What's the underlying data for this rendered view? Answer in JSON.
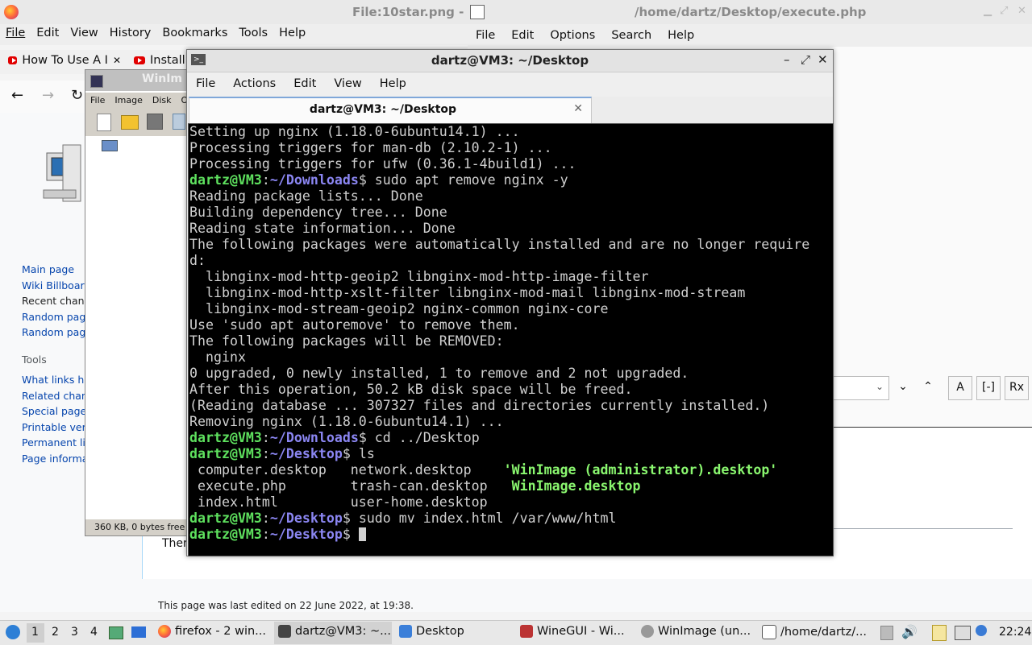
{
  "firefox": {
    "title": "File:10star.png -",
    "menu": [
      "File",
      "Edit",
      "View",
      "History",
      "Bookmarks",
      "Tools",
      "Help"
    ],
    "tabs": [
      "How To Use A I",
      "Installi"
    ],
    "wiki": {
      "nav_links": [
        "Main page",
        "Wiki Billboar",
        "Recent chan",
        "Random pag",
        "Random pag"
      ],
      "tools_heading": "Tools",
      "tool_links": [
        "What links he",
        "Related chan",
        "Special page",
        "Printable ver",
        "Permanent li",
        "Page informa"
      ],
      "body_fragment": "Ther",
      "footer": "This page was last edited on 22 June 2022, at 19:38."
    }
  },
  "editor": {
    "title": "/home/dartz/Desktop/execute.php",
    "menu": [
      "File",
      "Edit",
      "Options",
      "Search",
      "Help"
    ]
  },
  "winimage": {
    "title": "WinIm",
    "menu": [
      "File",
      "Image",
      "Disk",
      "Op"
    ],
    "status": "360 KB, 0 bytes free"
  },
  "terminal": {
    "title": "dartz@VM3: ~/Desktop",
    "menu": [
      "File",
      "Actions",
      "Edit",
      "View",
      "Help"
    ],
    "tab_title": "dartz@VM3: ~/Desktop",
    "lines": [
      [
        {
          "t": "Setting up nginx (1.18.0-6ubuntu14.1) ...",
          "c": ""
        }
      ],
      [
        {
          "t": "Processing triggers for man-db (2.10.2-1) ...",
          "c": ""
        }
      ],
      [
        {
          "t": "Processing triggers for ufw (0.36.1-4build1) ...",
          "c": ""
        }
      ],
      [
        {
          "t": "dartz@VM3",
          "c": "pg"
        },
        {
          "t": ":",
          "c": ""
        },
        {
          "t": "~/Downloads",
          "c": "pp"
        },
        {
          "t": "$ sudo apt remove nginx -y",
          "c": ""
        }
      ],
      [
        {
          "t": "Reading package lists... Done",
          "c": ""
        }
      ],
      [
        {
          "t": "Building dependency tree... Done",
          "c": ""
        }
      ],
      [
        {
          "t": "Reading state information... Done",
          "c": ""
        }
      ],
      [
        {
          "t": "The following packages were automatically installed and are no longer require",
          "c": ""
        }
      ],
      [
        {
          "t": "d:",
          "c": ""
        }
      ],
      [
        {
          "t": "  libnginx-mod-http-geoip2 libnginx-mod-http-image-filter",
          "c": ""
        }
      ],
      [
        {
          "t": "  libnginx-mod-http-xslt-filter libnginx-mod-mail libnginx-mod-stream",
          "c": ""
        }
      ],
      [
        {
          "t": "  libnginx-mod-stream-geoip2 nginx-common nginx-core",
          "c": ""
        }
      ],
      [
        {
          "t": "Use 'sudo apt autoremove' to remove them.",
          "c": ""
        }
      ],
      [
        {
          "t": "The following packages will be REMOVED:",
          "c": ""
        }
      ],
      [
        {
          "t": "  nginx",
          "c": ""
        }
      ],
      [
        {
          "t": "0 upgraded, 0 newly installed, 1 to remove and 2 not upgraded.",
          "c": ""
        }
      ],
      [
        {
          "t": "After this operation, 50.2 kB disk space will be freed.",
          "c": ""
        }
      ],
      [
        {
          "t": "(Reading database ... 307327 files and directories currently installed.)",
          "c": ""
        }
      ],
      [
        {
          "t": "Removing nginx (1.18.0-6ubuntu14.1) ...",
          "c": ""
        }
      ],
      [
        {
          "t": "dartz@VM3",
          "c": "pg"
        },
        {
          "t": ":",
          "c": ""
        },
        {
          "t": "~/Downloads",
          "c": "pp"
        },
        {
          "t": "$ cd ../Desktop",
          "c": ""
        }
      ],
      [
        {
          "t": "dartz@VM3",
          "c": "pg"
        },
        {
          "t": ":",
          "c": ""
        },
        {
          "t": "~/Desktop",
          "c": "pp"
        },
        {
          "t": "$ ls",
          "c": ""
        }
      ],
      [
        {
          "t": " computer.desktop   network.desktop    ",
          "c": ""
        },
        {
          "t": "'WinImage (administrator).desktop'",
          "c": "ex"
        }
      ],
      [
        {
          "t": " execute.php        trash-can.desktop   ",
          "c": ""
        },
        {
          "t": "WinImage.desktop",
          "c": "ex"
        }
      ],
      [
        {
          "t": " index.html         user-home.desktop",
          "c": ""
        }
      ],
      [
        {
          "t": "dartz@VM3",
          "c": "pg"
        },
        {
          "t": ":",
          "c": ""
        },
        {
          "t": "~/Desktop",
          "c": "pp"
        },
        {
          "t": "$ sudo mv index.html /var/www/html",
          "c": ""
        }
      ],
      [
        {
          "t": "dartz@VM3",
          "c": "pg"
        },
        {
          "t": ":",
          "c": ""
        },
        {
          "t": "~/Desktop",
          "c": "pp"
        },
        {
          "t": "$ ",
          "c": ""
        },
        {
          "t": "",
          "c": "cursor"
        }
      ]
    ]
  },
  "taskbar": {
    "workspaces": [
      "1",
      "2",
      "3",
      "4"
    ],
    "tasks": [
      "firefox - 2 win...",
      "dartz@VM3: ~...",
      "Desktop",
      "WineGUI - Wi...",
      "WinImage (un...",
      "/home/dartz/..."
    ],
    "clock": "22:24"
  }
}
